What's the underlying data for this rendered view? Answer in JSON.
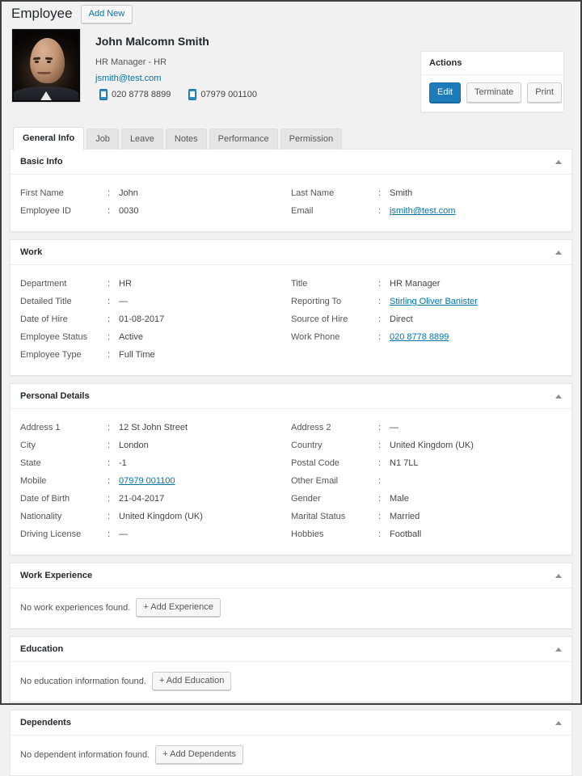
{
  "header": {
    "title": "Employee",
    "add_new_label": "Add New"
  },
  "profile": {
    "name": "John Malcomn Smith",
    "role": "HR Manager - HR",
    "email": "jsmith@test.com",
    "phones": [
      {
        "icon": "phone-icon",
        "number": "020 8778 8899"
      },
      {
        "icon": "mobile-icon",
        "number": "07979 001100"
      }
    ]
  },
  "actions": {
    "title": "Actions",
    "buttons": [
      {
        "label": "Edit",
        "style": "primary"
      },
      {
        "label": "Terminate",
        "style": "default"
      },
      {
        "label": "Print",
        "style": "default"
      }
    ]
  },
  "tabs": [
    {
      "label": "General Info",
      "active": true
    },
    {
      "label": "Job",
      "active": false
    },
    {
      "label": "Leave",
      "active": false
    },
    {
      "label": "Notes",
      "active": false
    },
    {
      "label": "Performance",
      "active": false
    },
    {
      "label": "Permission",
      "active": false
    }
  ],
  "sections": {
    "basic_info": {
      "title": "Basic Info",
      "left": [
        {
          "label": "First Name",
          "value": "John",
          "link": false
        },
        {
          "label": "Employee ID",
          "value": "0030",
          "link": false
        }
      ],
      "right": [
        {
          "label": "Last Name",
          "value": "Smith",
          "link": false
        },
        {
          "label": "Email",
          "value": "jsmith@test.com",
          "link": true
        }
      ]
    },
    "work": {
      "title": "Work",
      "left": [
        {
          "label": "Department",
          "value": "HR",
          "link": false
        },
        {
          "label": "Detailed Title",
          "value": "—",
          "link": false
        },
        {
          "label": "Date of Hire",
          "value": "01-08-2017",
          "link": false
        },
        {
          "label": "Employee Status",
          "value": "Active",
          "link": false
        },
        {
          "label": "Employee Type",
          "value": "Full Time",
          "link": false
        }
      ],
      "right": [
        {
          "label": "Title",
          "value": "HR Manager",
          "link": false
        },
        {
          "label": "Reporting To",
          "value": "Stirling Oliver Banister",
          "link": true
        },
        {
          "label": "Source of Hire",
          "value": "Direct",
          "link": false
        },
        {
          "label": "Work Phone",
          "value": "020 8778 8899",
          "link": true
        }
      ]
    },
    "personal_details": {
      "title": "Personal Details",
      "left": [
        {
          "label": "Address 1",
          "value": "12 St John Street",
          "link": false
        },
        {
          "label": "City",
          "value": "London",
          "link": false
        },
        {
          "label": "State",
          "value": "-1",
          "link": false
        },
        {
          "label": "Mobile",
          "value": "07979 001100",
          "link": true
        },
        {
          "label": "Date of Birth",
          "value": "21-04-2017",
          "link": false
        },
        {
          "label": "Nationality",
          "value": "United Kingdom (UK)",
          "link": false
        },
        {
          "label": "Driving License",
          "value": "—",
          "link": false
        }
      ],
      "right": [
        {
          "label": "Address 2",
          "value": "—",
          "link": false
        },
        {
          "label": "Country",
          "value": "United Kingdom (UK)",
          "link": false
        },
        {
          "label": "Postal Code",
          "value": "N1 7LL",
          "link": false
        },
        {
          "label": "Other Email",
          "value": "",
          "link": false
        },
        {
          "label": "Gender",
          "value": "Male",
          "link": false
        },
        {
          "label": "Marital Status",
          "value": "Married",
          "link": false
        },
        {
          "label": "Hobbies",
          "value": "Football",
          "link": false
        }
      ]
    },
    "work_experience": {
      "title": "Work Experience",
      "empty_text": "No work experiences found.",
      "add_label": "+ Add Experience"
    },
    "education": {
      "title": "Education",
      "empty_text": "No education information found.",
      "add_label": "+ Add Education"
    },
    "dependents": {
      "title": "Dependents",
      "empty_text": "No dependent information found.",
      "add_label": "+ Add Dependents"
    }
  },
  "colors": {
    "accent": "#0073aa",
    "primary_button": "#1d7bb9",
    "page_background": "#f1f1f1",
    "panel_background": "#ffffff"
  }
}
